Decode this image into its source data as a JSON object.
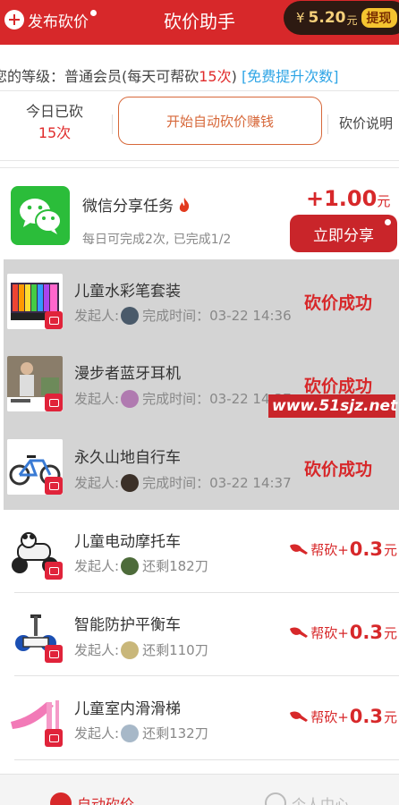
{
  "header": {
    "publish_label": "发布砍价",
    "title": "砍价助手",
    "wallet_currency": "¥",
    "wallet_amount": "5.20",
    "wallet_unit": "元",
    "withdraw_label": "提现"
  },
  "level": {
    "prefix": "您的等级：普通会员(每天可帮砍",
    "count": "15次",
    "suffix": ")",
    "upgrade_link": "[免费提升次数]"
  },
  "stats": {
    "today_label": "今日已砍",
    "today_count": "15次",
    "start_button": "开始自动砍价赚钱",
    "explain_label": "砍价说明"
  },
  "share_task": {
    "title": "微信分享任务",
    "subtitle": "每日可完成2次, 已完成1/2",
    "reward_amount": "+1.00",
    "reward_unit": "元",
    "button_label": "立即分享"
  },
  "tasks": [
    {
      "name": "儿童水彩笔套装",
      "initiator_label": "发起人:",
      "detail": "完成时间：03-22 14:36",
      "status": "砍价成功"
    },
    {
      "name": "漫步者蓝牙耳机",
      "initiator_label": "发起人:",
      "detail": "完成时间：03-22 14:37",
      "status": "砍价成功"
    },
    {
      "name": "永久山地自行车",
      "initiator_label": "发起人:",
      "detail": "完成时间：03-22 14:37",
      "status": "砍价成功"
    },
    {
      "name": "儿童电动摩托车",
      "initiator_label": "发起人:",
      "detail": "还剩182刀",
      "help_label": "帮砍+",
      "help_amount": "0.3",
      "help_unit": "元"
    },
    {
      "name": "智能防护平衡车",
      "initiator_label": "发起人:",
      "detail": "还剩110刀",
      "help_label": "帮砍+",
      "help_amount": "0.3",
      "help_unit": "元"
    },
    {
      "name": "儿童室内滑滑梯",
      "initiator_label": "发起人:",
      "detail": "还剩132刀",
      "help_label": "帮砍+",
      "help_amount": "0.3",
      "help_unit": "元"
    }
  ],
  "watermark": "www.51sjz.net",
  "tabbar": {
    "tab_bargain": "自动砍价",
    "tab_profile": "个人中心"
  },
  "colors": {
    "brand_red": "#d7282a",
    "link_blue": "#2fa5e6",
    "wallet_bg": "#2d1a12",
    "completed_bg": "#d4d4d4"
  }
}
